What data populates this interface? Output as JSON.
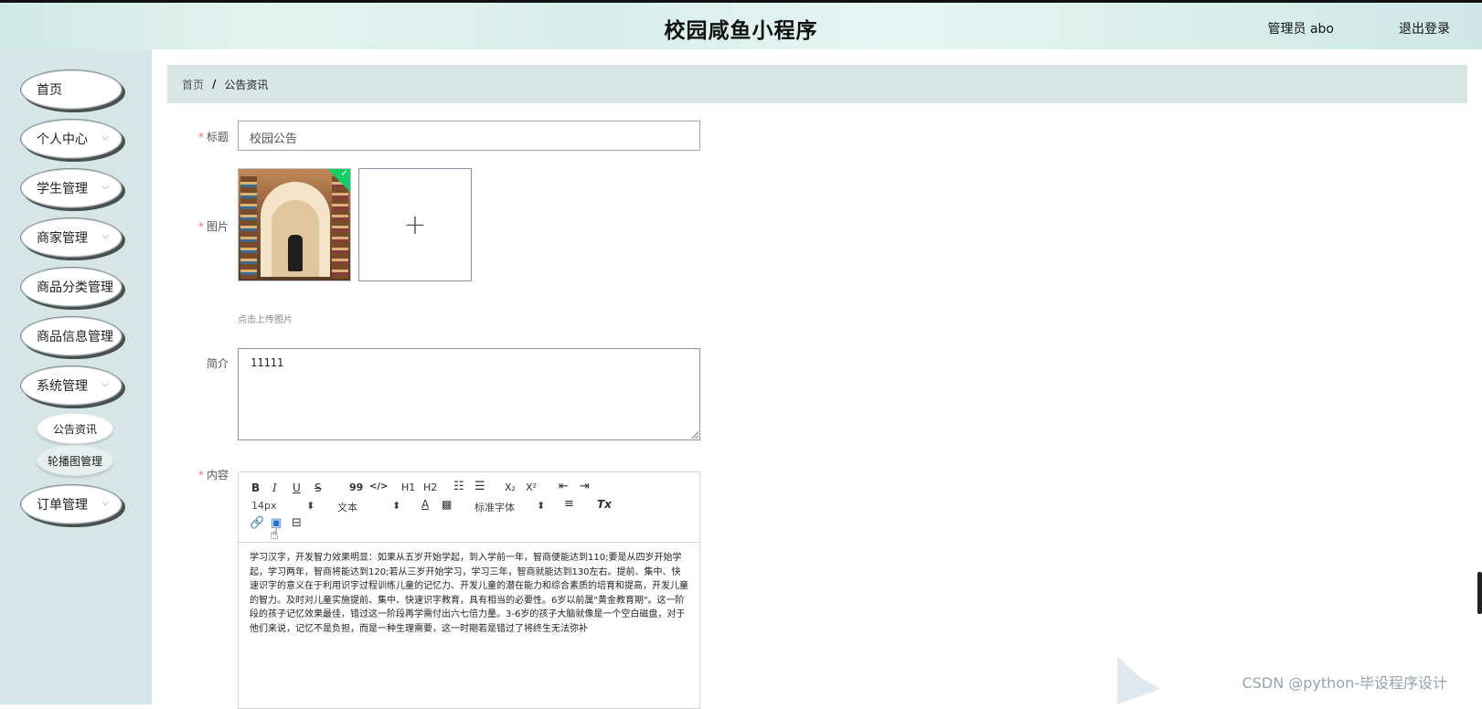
{
  "header": {
    "title": "校园咸鱼小程序",
    "admin": "管理员 abo",
    "logout": "退出登录"
  },
  "sidebar": {
    "items": [
      {
        "label": "首页"
      },
      {
        "label": "个人中心",
        "chevron": "chevron-down-icon"
      },
      {
        "label": "学生管理",
        "chevron": "chevron-down-icon"
      },
      {
        "label": "商家管理",
        "chevron": "chevron-down-icon"
      },
      {
        "label": "商品分类管理"
      },
      {
        "label": "商品信息管理"
      },
      {
        "label": "系统管理",
        "chevron": "chevron-down-icon"
      },
      {
        "label": "订单管理",
        "chevron": "chevron-down-icon"
      }
    ],
    "sub_items": [
      {
        "label": "公告资讯"
      },
      {
        "label": "轮播图管理"
      }
    ]
  },
  "breadcrumb": {
    "home": "首页",
    "separator": "/",
    "current": "公告资讯"
  },
  "form": {
    "required_mark": "*",
    "title_label": "标题",
    "title_value": "校园公告",
    "image_label": "图片",
    "upload_plus": "+",
    "upload_hint": "点击上传图片",
    "intro_label": "简介",
    "intro_value": "11111",
    "content_label": "内容"
  },
  "editor": {
    "toolbar": {
      "bold": "B",
      "italic": "I",
      "underline": "U",
      "strike": "S",
      "quote": "99",
      "code": "</>",
      "h1": "H1",
      "h2": "H2",
      "sub": "X₂",
      "sup": "X²",
      "size_select": "14px",
      "para_select": "文本",
      "font_select": "标准字体",
      "clear_format": "Tx",
      "select_arrow": "⬍"
    },
    "body": "学习汉字，开发智力效果明显：如果从五岁开始学起，到入学前一年，智商便能达到110;要是从四岁开始学起，学习两年，智商将能达到120;若从三岁开始学习，学习三年，智商就能达到130左右。提前、集中、快速识字的意义在于利用识字过程训练儿童的记忆力、开发儿童的潜在能力和综合素质的培育和提高，开发儿童的智力。及时对儿童实施提前、集中、快速识字教育，具有相当的必要性。6岁以前属\"黄金教育期\"。这一阶段的孩子记忆效果最佳，错过这一阶段再学需付出六七倍力量。3-6岁的孩子大脑就像是一个空白磁盘，对于他们来说，记忆不是负担，而是一种生理需要，这一时期若是错过了将终生无法弥补"
  },
  "watermark": "CSDN @python-毕设程序设计",
  "colors": {
    "sidebar_bg": "#d6e6e6",
    "breadcrumb_bg": "#d9e6e6",
    "required": "#f56c6c",
    "upload_success": "#13ce66"
  }
}
